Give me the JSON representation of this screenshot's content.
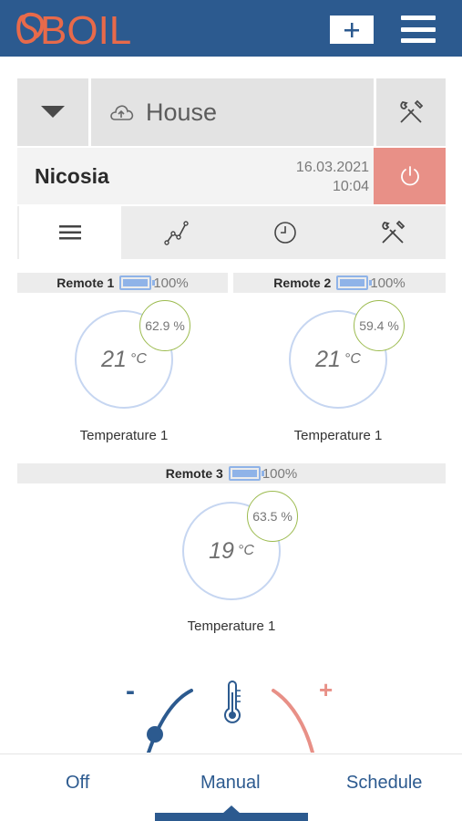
{
  "header": {
    "logo_text": "BOIL",
    "logo_color": "#e86a4a",
    "add_icon": "plus-icon",
    "menu_icon": "hamburger-icon",
    "bar_color": "#2c5a8f"
  },
  "location": {
    "dropdown_icon": "caret-down-icon",
    "cloud_icon": "cloud-upload-icon",
    "name": "House",
    "tools_icon": "tools-icon"
  },
  "city": {
    "name": "Nicosia",
    "date": "16.03.2021",
    "time": "10:04",
    "power_icon": "power-icon",
    "power_color": "#e89087"
  },
  "tabs": [
    {
      "icon": "list-icon",
      "active": true
    },
    {
      "icon": "chart-line-icon",
      "active": false
    },
    {
      "icon": "clock-icon",
      "active": false
    },
    {
      "icon": "tools-icon",
      "active": false
    }
  ],
  "remotes": [
    {
      "name": "Remote 1",
      "battery": "100%",
      "temperature": "21",
      "unit": "°C",
      "humidity": "62.9 %",
      "label": "Temperature 1"
    },
    {
      "name": "Remote 2",
      "battery": "100%",
      "temperature": "21",
      "unit": "°C",
      "humidity": "59.4 %",
      "label": "Temperature 1"
    },
    {
      "name": "Remote 3",
      "battery": "100%",
      "temperature": "19",
      "unit": "°C",
      "humidity": "63.5 %",
      "label": "Temperature 1"
    }
  ],
  "dial": {
    "minus": "-",
    "plus": "+",
    "thermometer_icon": "thermometer-icon"
  },
  "nav": {
    "off": "Off",
    "manual": "Manual",
    "schedule": "Schedule",
    "active": "Manual"
  }
}
